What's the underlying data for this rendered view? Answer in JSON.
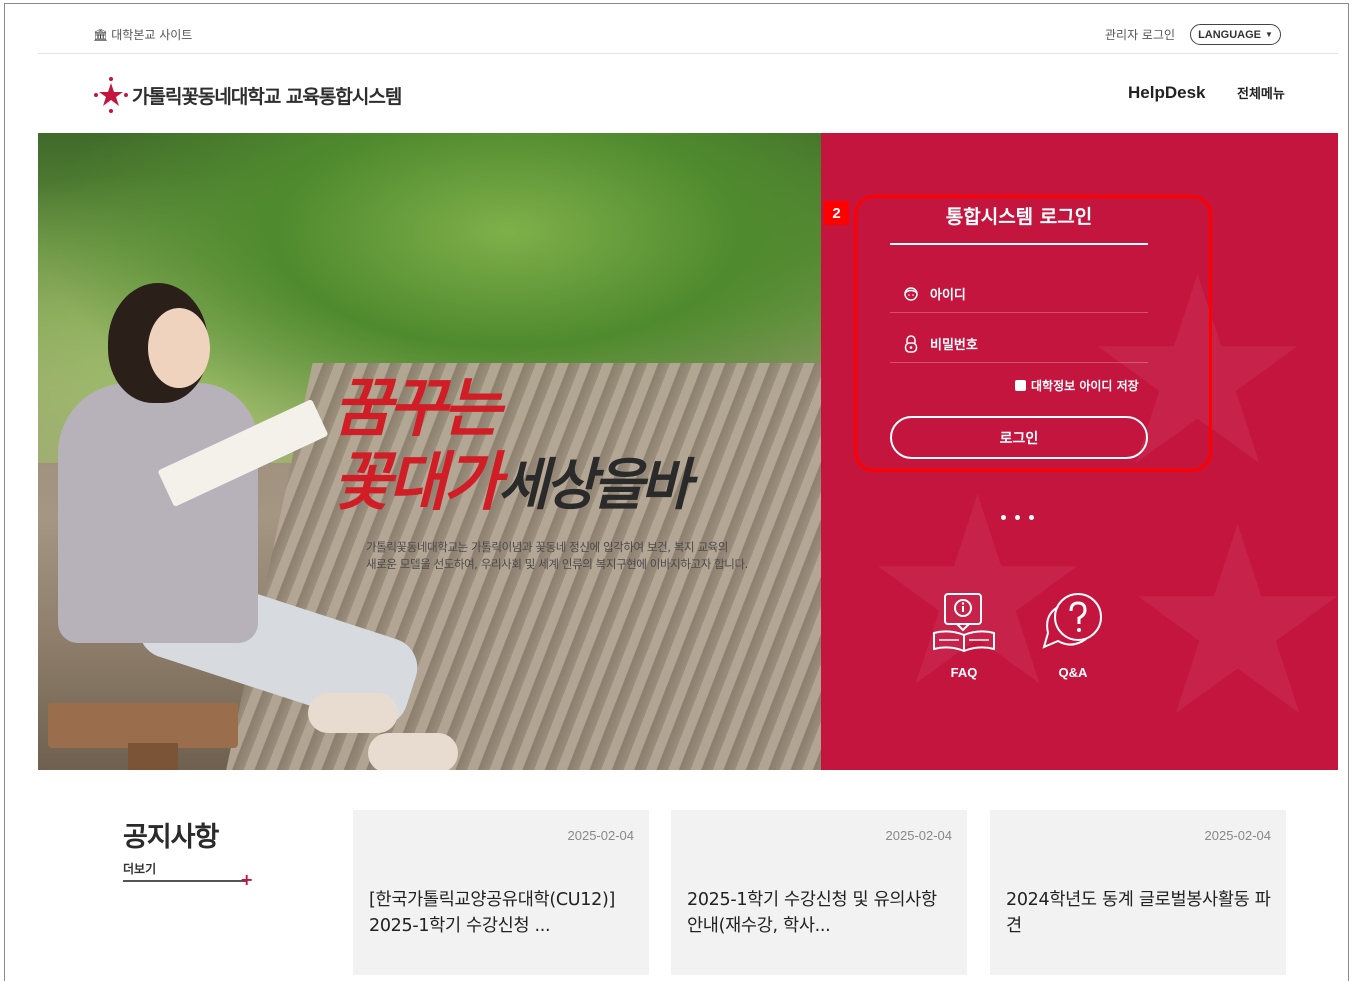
{
  "topbar": {
    "univ_site": "대학본교 사이트",
    "admin_login": "관리자 로그인",
    "language": "LANGUAGE"
  },
  "header": {
    "title": "가톨릭꽃동네대학교 교육통합시스템",
    "helpdesk": "HelpDesk",
    "all_menu": "전체메뉴"
  },
  "hero": {
    "slogan_line1": "꿈꾸는",
    "slogan_line2": "꽃대가",
    "slogan_line3": "세상을바",
    "description_line1": "가톨릭꽃동네대학교는 가톨릭이념과 꽃동네 정신에 입각하여 보건, 복지 교육의",
    "description_line2": "새로운 모델을 선도하여, 우리사회 및 세계 인류의 복지구현에 이바지하고자 합니다."
  },
  "login": {
    "annotation_tag": "2",
    "title": "통합시스템 로그인",
    "id_label": "아이디",
    "password_label": "비밀번호",
    "save_id_label": "대학정보 아이디 저장",
    "login_button": "로그인"
  },
  "quick_links": {
    "faq": "FAQ",
    "qna": "Q&A"
  },
  "notices": {
    "title": "공지사항",
    "more": "더보기",
    "items": [
      {
        "date": "2025-02-04",
        "title": "[한국가톨릭교양공유대학(CU12)] 2025-1학기 수강신청 ..."
      },
      {
        "date": "2025-02-04",
        "title": "2025-1학기 수강신청 및 유의사항 안내(재수강, 학사..."
      },
      {
        "date": "2025-02-04",
        "title": "2024학년도 동계 글로벌봉사활동 파견"
      }
    ]
  },
  "colors": {
    "brand_red": "#c4153f",
    "highlight_red": "#ff0000"
  }
}
